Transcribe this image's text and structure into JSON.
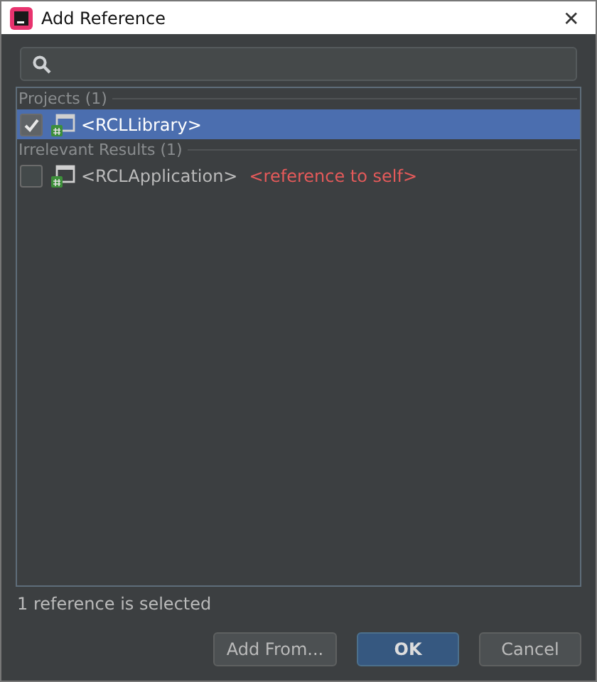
{
  "window": {
    "title": "Add Reference",
    "close": "✕"
  },
  "groups": [
    {
      "label": "Projects (1)",
      "items": [
        {
          "name": "<RCLLibrary>",
          "checked": true,
          "selected": true
        }
      ]
    },
    {
      "label": "Irrelevant Results (1)",
      "items": [
        {
          "name": "<RCLApplication>",
          "checked": false,
          "selected": false,
          "note": "<reference to self>"
        }
      ]
    }
  ],
  "status": "1 reference is selected",
  "buttons": [
    {
      "label": "Add From...",
      "kind": "normal"
    },
    {
      "label": "OK",
      "kind": "default"
    },
    {
      "label": "Cancel",
      "kind": "normal"
    }
  ]
}
